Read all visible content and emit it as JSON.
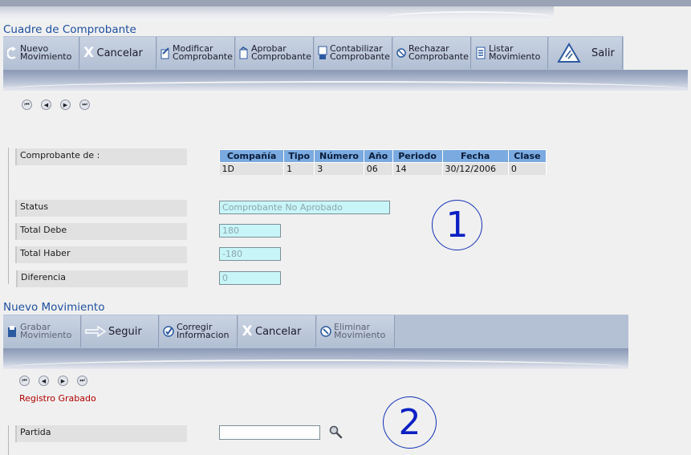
{
  "section1": {
    "title": "Cuadre de Comprobante",
    "toolbar": [
      {
        "label": "Nuevo\nMovimiento",
        "icon": "refresh-arrow-icon"
      },
      {
        "label": "Cancelar",
        "icon": "x-icon",
        "big": true
      },
      {
        "label": "Modificar\nComprobante",
        "icon": "edit-document-icon"
      },
      {
        "label": "Aprobar\nComprobante",
        "icon": "approve-document-icon"
      },
      {
        "label": "Contabilizar\nComprobante",
        "icon": "post-document-icon"
      },
      {
        "label": "Rechazar\nComprobante",
        "icon": "reject-icon"
      },
      {
        "label": "Listar\nMovimiento",
        "icon": "list-icon"
      },
      {
        "label": "Salir",
        "icon": "exit-icon",
        "big": true
      }
    ],
    "comprobante_label": "Comprobante de :",
    "table": {
      "headers": [
        "Compañía",
        "Tipo",
        "Número",
        "Año",
        "Periodo",
        "Fecha",
        "Clase"
      ],
      "row": [
        "1D",
        "1",
        "3",
        "06",
        "14",
        "30/12/2006",
        "0"
      ]
    },
    "status_label": "Status",
    "status_value": "Comprobante No Aprobado",
    "total_debe_label": "Total Debe",
    "total_debe_value": "180",
    "total_haber_label": "Total Haber",
    "total_haber_value": "-180",
    "diferencia_label": "Diferencia",
    "diferencia_value": "0",
    "marker": "1"
  },
  "section2": {
    "title": "Nuevo Movimiento",
    "toolbar": [
      {
        "label": "Grabar\nMovimiento",
        "icon": "save-icon",
        "disabled": true
      },
      {
        "label": "Seguir",
        "icon": "arrow-right-icon",
        "big": true
      },
      {
        "label": "Corregir\nInformacion",
        "icon": "correct-icon"
      },
      {
        "label": "Cancelar",
        "icon": "x-icon",
        "big": true
      },
      {
        "label": "Eliminar\nMovimiento",
        "icon": "delete-icon",
        "disabled": true
      }
    ],
    "status_message": "Registro Grabado",
    "partida_label": "Partida",
    "partida_value": "",
    "marker": "2"
  },
  "colors": {
    "title": "#1c4f9e",
    "toolbar": "#b4c1d5",
    "header": "#7aaadf",
    "field_bg": "#c8f5f8",
    "message": "#b00000",
    "marker": "#0b20c4"
  }
}
